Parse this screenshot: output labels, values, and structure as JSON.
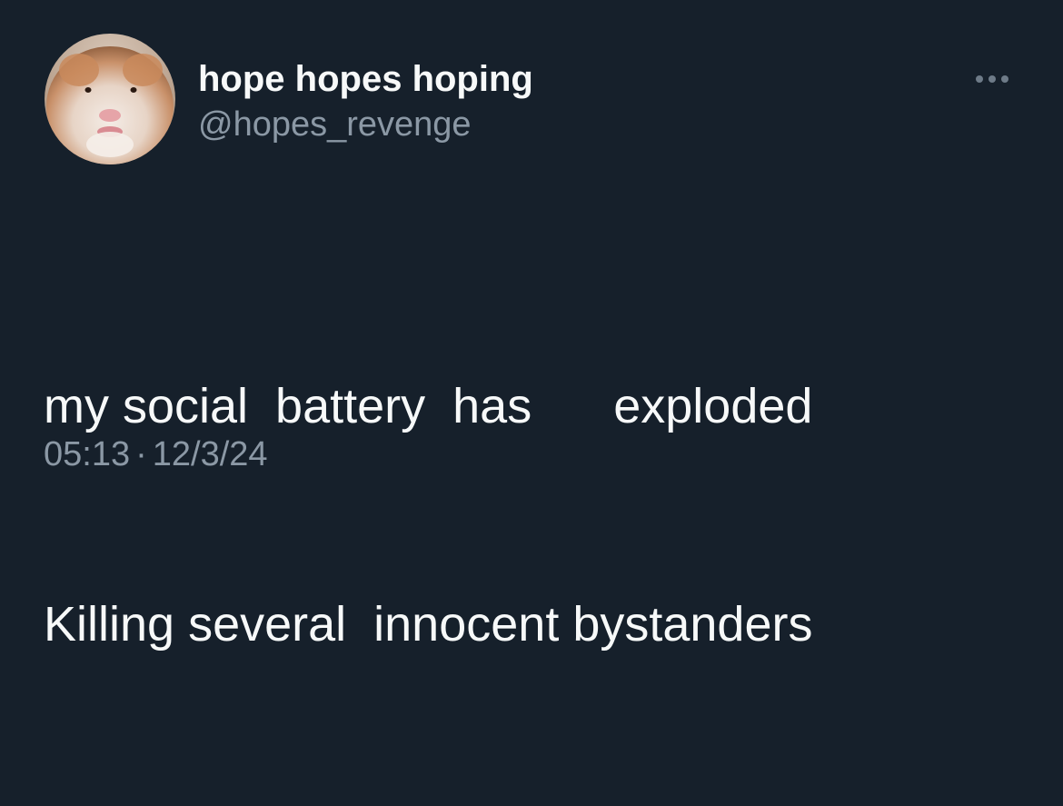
{
  "user": {
    "display_name": "hope hopes hoping",
    "handle": "@hopes_revenge"
  },
  "more_button": {
    "icon": "more-horizontal-icon"
  },
  "tweet": {
    "lines": [
      "my social  battery  has      exploded",
      "Killing several  innocent bystanders"
    ]
  },
  "meta": {
    "time": "05:13",
    "separator": "·",
    "date": "12/3/24"
  },
  "colors": {
    "background": "#16202b",
    "primary_text": "#f7f9f9",
    "secondary_text": "#8b98a5"
  }
}
